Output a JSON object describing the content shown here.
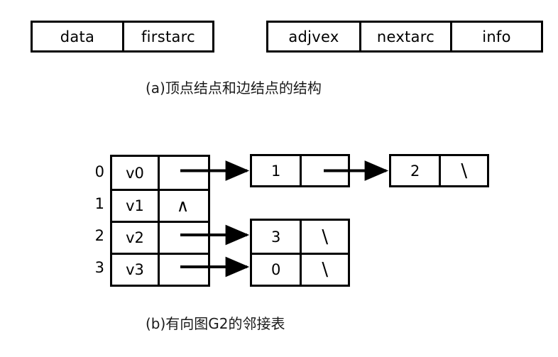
{
  "diagram": {
    "part_a": {
      "caption": "(a)顶点结点和边结点的结构",
      "vertex_node": {
        "name": "vertex-node-structure",
        "fields": [
          "data",
          "firstarc"
        ]
      },
      "arc_node": {
        "name": "arc-node-structure",
        "fields": [
          "adjvex",
          "nextarc",
          "info"
        ]
      }
    },
    "part_b": {
      "caption": "(b)有向图G2的邻接表",
      "vertex_table": {
        "indices": [
          "0",
          "1",
          "2",
          "3"
        ],
        "rows": [
          {
            "index": "0",
            "data": "v0",
            "pointer": "",
            "has_arrow": true
          },
          {
            "index": "1",
            "data": "v1",
            "pointer": "∧",
            "has_arrow": false
          },
          {
            "index": "2",
            "data": "v2",
            "pointer": "",
            "has_arrow": true
          },
          {
            "index": "3",
            "data": "v3",
            "pointer": "",
            "has_arrow": true
          }
        ]
      },
      "arc_nodes": [
        {
          "id": "arc-v0-1",
          "adjvex": "1",
          "next": "",
          "has_arrow": true
        },
        {
          "id": "arc-v0-2",
          "adjvex": "2",
          "next": "\\",
          "has_arrow": false
        },
        {
          "id": "arc-v2-3",
          "adjvex": "3",
          "next": "\\",
          "has_arrow": false
        },
        {
          "id": "arc-v3-0",
          "adjvex": "0",
          "next": "\\",
          "has_arrow": false
        }
      ]
    }
  },
  "colors": {
    "stroke": "#000000",
    "background": "#ffffff",
    "text": "#000000"
  }
}
